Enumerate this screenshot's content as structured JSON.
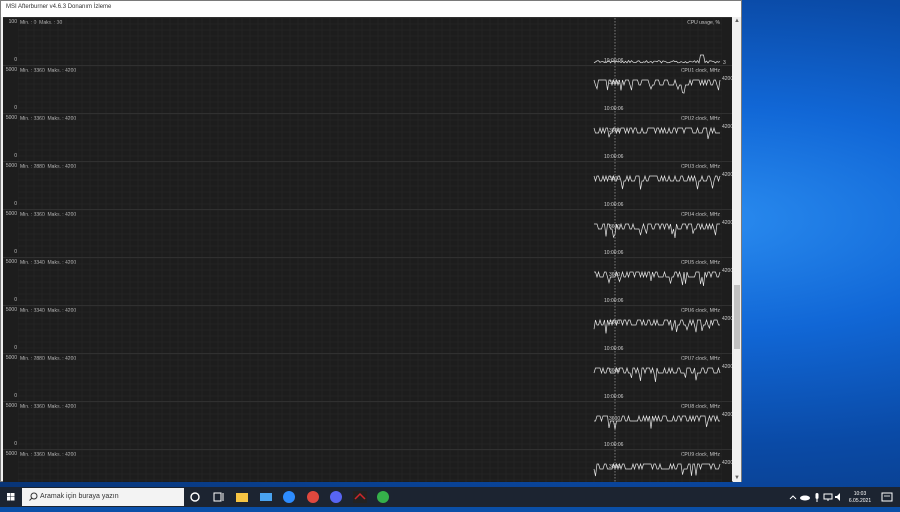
{
  "window": {
    "title": "MSI Afterburner v4.6.3 Donanım İzleme"
  },
  "panels": [
    {
      "name": "CPU usage, %",
      "top_scale": "100",
      "bottom_scale": "0",
      "min": "0",
      "max": "30",
      "current": "3"
    },
    {
      "name": "CPU1 clock, MHz",
      "top_scale": "5000",
      "bottom_scale": "0",
      "min": "3360",
      "max": "4200",
      "current": "4200"
    },
    {
      "name": "CPU2 clock, MHz",
      "top_scale": "5000",
      "bottom_scale": "0",
      "min": "3360",
      "max": "4200",
      "current": "4200"
    },
    {
      "name": "CPU3 clock, MHz",
      "top_scale": "5000",
      "bottom_scale": "0",
      "min": "2880",
      "max": "4200",
      "current": "4200"
    },
    {
      "name": "CPU4 clock, MHz",
      "top_scale": "5000",
      "bottom_scale": "0",
      "min": "3360",
      "max": "4200",
      "current": "4200"
    },
    {
      "name": "CPU5 clock, MHz",
      "top_scale": "5000",
      "bottom_scale": "0",
      "min": "3340",
      "max": "4200",
      "current": "4200"
    },
    {
      "name": "CPU6 clock, MHz",
      "top_scale": "5000",
      "bottom_scale": "0",
      "min": "3340",
      "max": "4200",
      "current": "4200"
    },
    {
      "name": "CPU7 clock, MHz",
      "top_scale": "5000",
      "bottom_scale": "0",
      "min": "2880",
      "max": "4200",
      "current": "4200"
    },
    {
      "name": "CPU8 clock, MHz",
      "top_scale": "5000",
      "bottom_scale": "0",
      "min": "3360",
      "max": "4200",
      "current": "4200"
    },
    {
      "name": "CPU9 clock, MHz",
      "top_scale": "5000",
      "bottom_scale": "0",
      "min": "3360",
      "max": "4200",
      "current": "4200"
    }
  ],
  "labels": {
    "min_prefix": "Min. : ",
    "max_prefix": "  Maks. : ",
    "timestamp": "10:00:06",
    "marker_value": "3600"
  },
  "taskbar": {
    "search_placeholder": "Aramak için buraya yazın",
    "icons": [
      "cortana-icon",
      "task-view-icon",
      "file-explorer-icon",
      "mail-icon",
      "zoom-icon",
      "chrome-icon",
      "discord-icon",
      "msi-afterburner-icon",
      "xbox-app-icon"
    ],
    "time": "10:03",
    "date": "6.05.2021"
  },
  "colors": {
    "graph_bg": "#1d1d1d",
    "grid": "#2e2e2e",
    "line": "#e6e6e6",
    "taskbar": "#1c2431"
  }
}
